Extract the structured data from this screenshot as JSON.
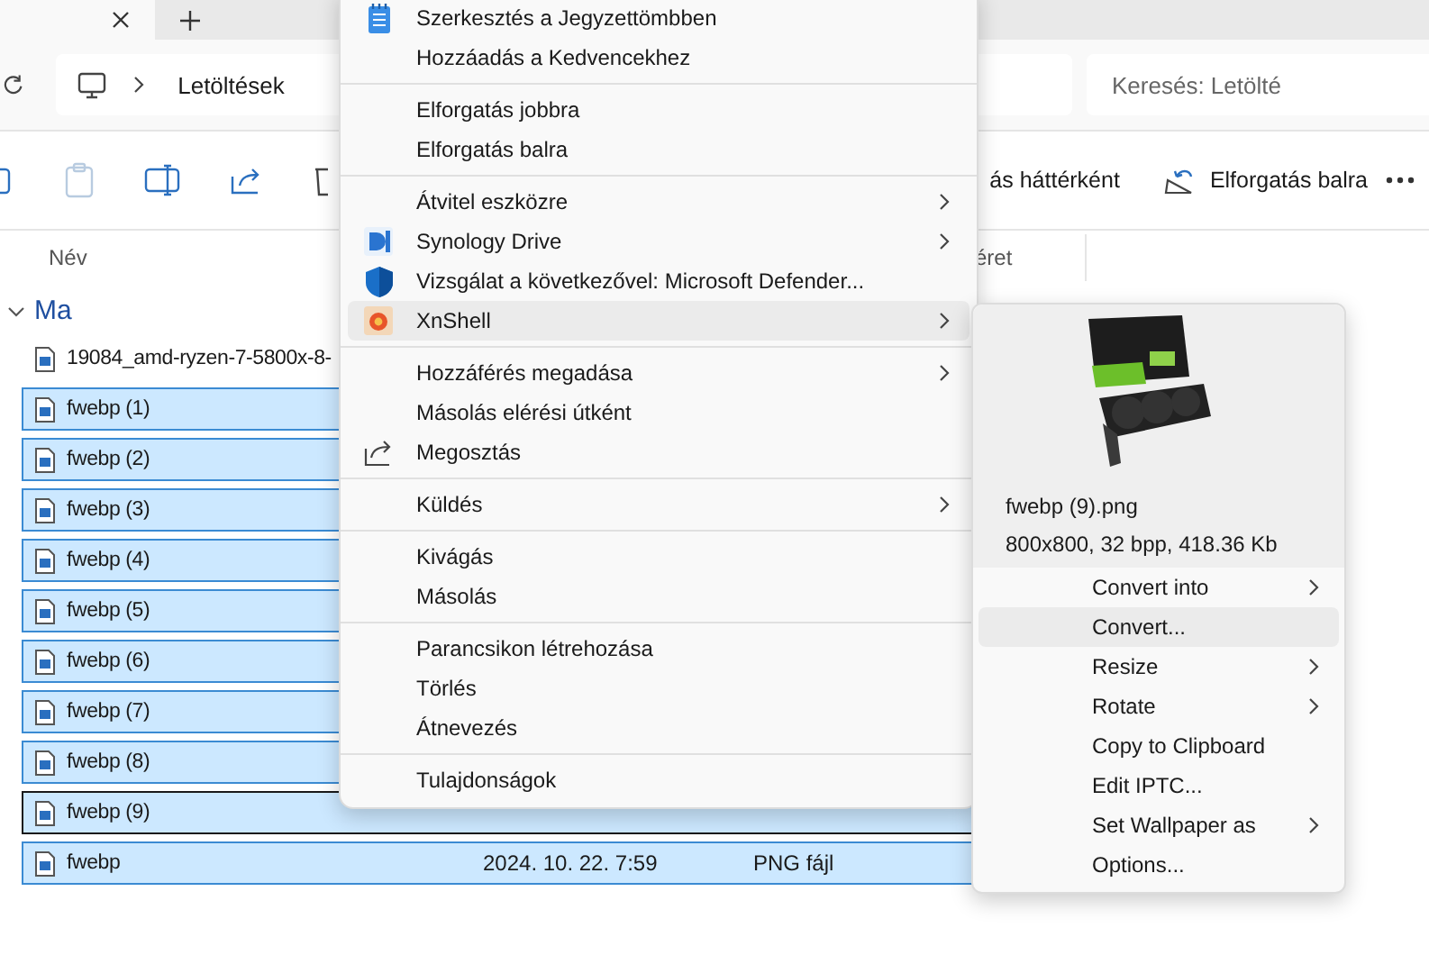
{
  "address": {
    "path": "Letöltések"
  },
  "search": {
    "placeholder": "Keresés: Letölté"
  },
  "toolbar": {
    "labels": [
      {
        "kind": "partial",
        "label": "ás háttérként"
      },
      {
        "kind": "rotate",
        "label": "Elforgatás balra"
      }
    ]
  },
  "columns": [
    "Név",
    "éret"
  ],
  "group": {
    "label": "Ma",
    "expanded": true
  },
  "files": [
    {
      "name": "19084_amd-ryzen-7-5800x-8-",
      "selected": false,
      "focused": false
    },
    {
      "name": "fwebp (1)",
      "selected": true,
      "focused": false
    },
    {
      "name": "fwebp (2)",
      "selected": true,
      "focused": false
    },
    {
      "name": "fwebp (3)",
      "selected": true,
      "focused": false
    },
    {
      "name": "fwebp (4)",
      "selected": true,
      "focused": false
    },
    {
      "name": "fwebp (5)",
      "selected": true,
      "focused": false
    },
    {
      "name": "fwebp (6)",
      "selected": true,
      "focused": false
    },
    {
      "name": "fwebp (7)",
      "selected": true,
      "focused": false
    },
    {
      "name": "fwebp (8)",
      "selected": true,
      "focused": false
    },
    {
      "name": "fwebp (9)",
      "selected": true,
      "focused": true
    },
    {
      "name": "fwebp",
      "selected": true,
      "focused": false,
      "date": "2024. 10. 22. 7:59",
      "type": "PNG fájl"
    }
  ],
  "context_menu": {
    "sections": [
      [
        {
          "label": "Szerkesztés a Jegyzettömbben",
          "submenu": false,
          "highlighted": false
        },
        {
          "label": "Hozzáadás a Kedvencekhez",
          "submenu": false,
          "highlighted": false
        }
      ],
      [
        {
          "label": "Elforgatás jobbra",
          "submenu": false,
          "highlighted": false
        },
        {
          "label": "Elforgatás balra",
          "submenu": false,
          "highlighted": false
        }
      ],
      [
        {
          "label": "Átvitel eszközre",
          "submenu": true,
          "highlighted": false
        },
        {
          "label": "Synology Drive",
          "submenu": true,
          "highlighted": false
        },
        {
          "label": "Vizsgálat a következővel: Microsoft Defender...",
          "submenu": false,
          "highlighted": false
        },
        {
          "label": "XnShell",
          "submenu": true,
          "highlighted": true
        }
      ],
      [
        {
          "label": "Hozzáférés megadása",
          "submenu": true,
          "highlighted": false
        },
        {
          "label": "Másolás elérési útként",
          "submenu": false,
          "highlighted": false
        },
        {
          "label": "Megosztás",
          "submenu": false,
          "highlighted": false
        }
      ],
      [
        {
          "label": "Küldés",
          "submenu": true,
          "highlighted": false
        }
      ],
      [
        {
          "label": "Kivágás",
          "submenu": false,
          "highlighted": false
        },
        {
          "label": "Másolás",
          "submenu": false,
          "highlighted": false
        }
      ],
      [
        {
          "label": "Parancsikon létrehozása",
          "submenu": false,
          "highlighted": false
        },
        {
          "label": "Törlés",
          "submenu": false,
          "highlighted": false
        },
        {
          "label": "Átnevezés",
          "submenu": false,
          "highlighted": false
        }
      ],
      [
        {
          "label": "Tulajdonságok",
          "submenu": false,
          "highlighted": false
        }
      ]
    ]
  },
  "submenu": {
    "file_name": "fwebp (9).png",
    "file_info": "800x800, 32 bpp, 418.36 Kb",
    "items": [
      {
        "label": "Convert into",
        "submenu": true,
        "highlighted": false
      },
      {
        "label": "Convert...",
        "submenu": false,
        "highlighted": true
      },
      {
        "label": "Resize",
        "submenu": true,
        "highlighted": false
      },
      {
        "label": "Rotate",
        "submenu": true,
        "highlighted": false
      },
      {
        "label": "Copy to Clipboard",
        "submenu": false,
        "highlighted": false
      },
      {
        "label": "Edit IPTC...",
        "submenu": false,
        "highlighted": false
      },
      {
        "label": "Set Wallpaper as",
        "submenu": true,
        "highlighted": false
      },
      {
        "label": "Options...",
        "submenu": false,
        "highlighted": false
      }
    ]
  }
}
